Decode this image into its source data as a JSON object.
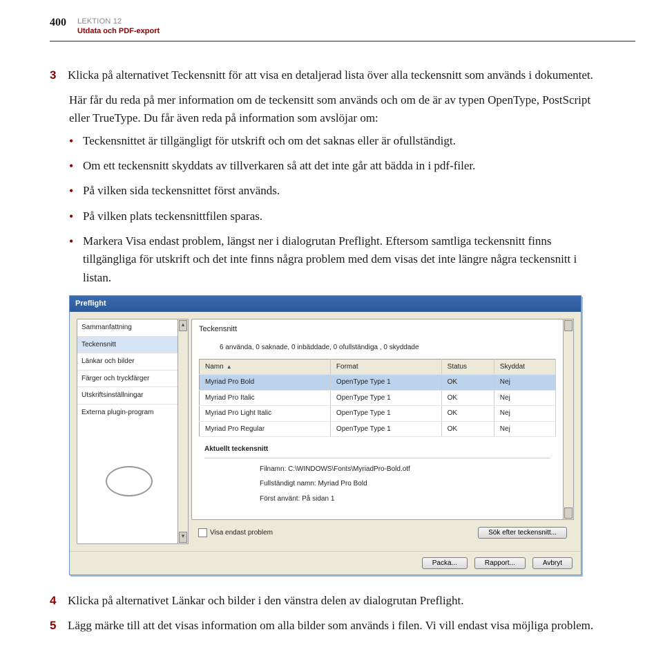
{
  "header": {
    "page_number": "400",
    "lesson_line1": "LEKTION 12",
    "lesson_line2": "Utdata och PDF-export"
  },
  "step3": {
    "num": "3",
    "para1": "Klicka på alternativet Teckensnitt för att visa en detaljerad lista över alla teckensnitt som används i dokumentet.",
    "para2": "Här får du reda på mer information om de teckensitt som används och om de är av typen OpenType, PostScript eller TrueType. Du får även reda på information som avslöjar om:"
  },
  "bullets": [
    "Teckensnittet är tillgängligt för utskrift och om det saknas eller är ofullständigt.",
    "Om ett teckensnitt skyddats av tillverkaren så att det inte går att bädda in i pdf-filer.",
    "På vilken sida teckensnittet först används.",
    "På vilken plats teckensnittfilen sparas.",
    "Markera Visa endast problem, längst ner i dialogrutan Preflight. Eftersom samtliga teckensnitt finns tillgängliga för utskrift och det inte finns några problem med dem visas det inte längre några teckensnitt i listan."
  ],
  "dialog": {
    "title": "Preflight",
    "sidebar": [
      "Sammanfattning",
      "Teckensnitt",
      "Länkar och bilder",
      "Färger och tryckfärger",
      "Utskriftsinställningar",
      "Externa plugin-program"
    ],
    "panel_heading": "Teckensnitt",
    "summary": "6 använda, 0 saknade, 0 inbäddade, 0 ofullständiga , 0 skyddade",
    "columns": [
      "Namn",
      "Format",
      "Status",
      "Skyddat"
    ],
    "rows": [
      {
        "name": "Myriad Pro Bold",
        "format": "OpenType Type 1",
        "status": "OK",
        "protected": "Nej",
        "selected": true
      },
      {
        "name": "Myriad Pro Italic",
        "format": "OpenType Type 1",
        "status": "OK",
        "protected": "Nej"
      },
      {
        "name": "Myriad Pro Light Italic",
        "format": "OpenType Type 1",
        "status": "OK",
        "protected": "Nej"
      },
      {
        "name": "Myriad Pro Regular",
        "format": "OpenType Type 1",
        "status": "OK",
        "protected": "Nej"
      }
    ],
    "detail_heading": "Aktuellt teckensnitt",
    "detail_filename_label": "Filnamn:",
    "detail_filename": "C:\\WINDOWS\\Fonts\\MyriadPro-Bold.otf",
    "detail_fullname_label": "Fullständigt namn:",
    "detail_fullname": "Myriad Pro Bold",
    "detail_firstused_label": "Först använt:",
    "detail_firstused": "På sidan 1",
    "show_problems_label": "Visa endast problem",
    "search_font_btn": "Sök efter teckensnitt...",
    "bottom_buttons": [
      "Packa...",
      "Rapport...",
      "Avbryt"
    ]
  },
  "step4": {
    "num": "4",
    "text": "Klicka på alternativet Länkar och bilder i den vänstra delen av dialogrutan Preflight."
  },
  "step5": {
    "num": "5",
    "text": "Lägg märke till att det visas information om alla bilder som används i filen. Vi vill endast visa möjliga problem."
  }
}
